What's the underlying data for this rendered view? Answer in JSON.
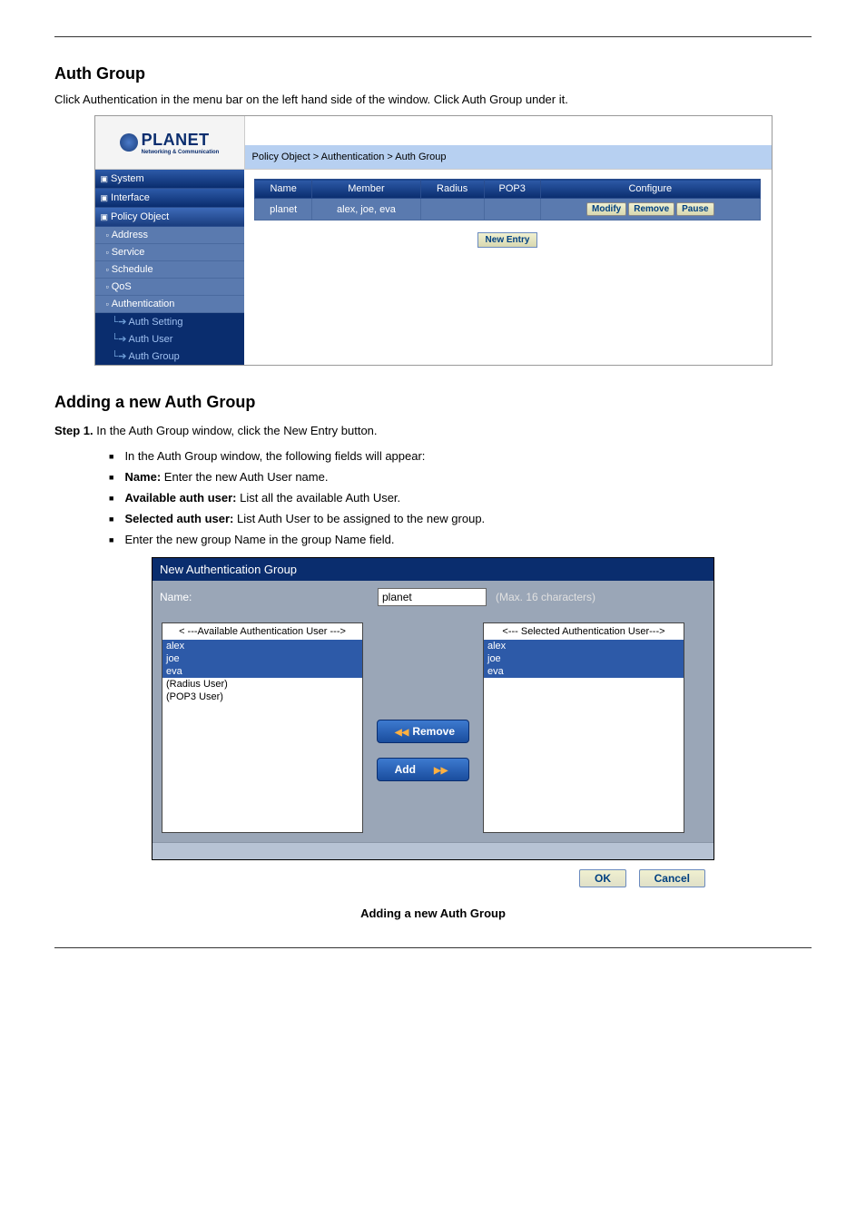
{
  "header": {
    "section_title": "Auth Group",
    "intro": "Click Authentication in the menu bar on the left hand side of the window. Click Auth Group under it."
  },
  "screenshot1": {
    "logo_brand": "PLANET",
    "logo_tag": "Networking & Communication",
    "breadcrumb": "Policy Object > Authentication > Auth Group",
    "nav": {
      "system": "System",
      "interface": "Interface",
      "policy_object": "Policy Object",
      "address": "Address",
      "service": "Service",
      "schedule": "Schedule",
      "qos": "QoS",
      "authentication": "Authentication",
      "auth_setting": "Auth Setting",
      "auth_user": "Auth User",
      "auth_group": "Auth Group"
    },
    "table": {
      "headers": {
        "name": "Name",
        "member": "Member",
        "radius": "Radius",
        "pop3": "POP3",
        "configure": "Configure"
      },
      "row": {
        "name": "planet",
        "member": "alex, joe, eva",
        "radius": "",
        "pop3": ""
      },
      "btn_modify": "Modify",
      "btn_remove": "Remove",
      "btn_pause": "Pause",
      "btn_new_entry": "New  Entry"
    }
  },
  "steps": {
    "title_step1": "Step 1.",
    "step1_text": "In the Auth Group window, click the New Entry button.",
    "bullets": {
      "b1_pre": "In the Auth Group window, the following fields will appear:",
      "b2_lbl": "Name:",
      "b2_txt": " Enter the new Auth User name.",
      "b3_lbl": "Available auth user:",
      "b3_txt": " List all the available Auth User.",
      "b4_lbl": "Selected auth user:",
      "b4_txt": " List Auth User to be assigned to the new group.",
      "b5_txt": "Enter the new group Name in the group Name field."
    }
  },
  "figure2": {
    "panel_title": "New Authentication Group",
    "name_label": "Name:",
    "name_value": "planet",
    "name_hint": "(Max. 16 characters)",
    "available_label": "< ---Available Authentication User --->",
    "available_items": [
      "alex",
      "joe",
      "eva",
      "(Radius User)",
      "(POP3 User)"
    ],
    "selected_label": "<--- Selected Authentication User--->",
    "selected_items": [
      "alex",
      "joe",
      "eva"
    ],
    "btn_remove": "Remove",
    "btn_add": "Add",
    "btn_ok": "OK",
    "btn_cancel": "Cancel"
  },
  "caption": "Adding a new Auth Group"
}
